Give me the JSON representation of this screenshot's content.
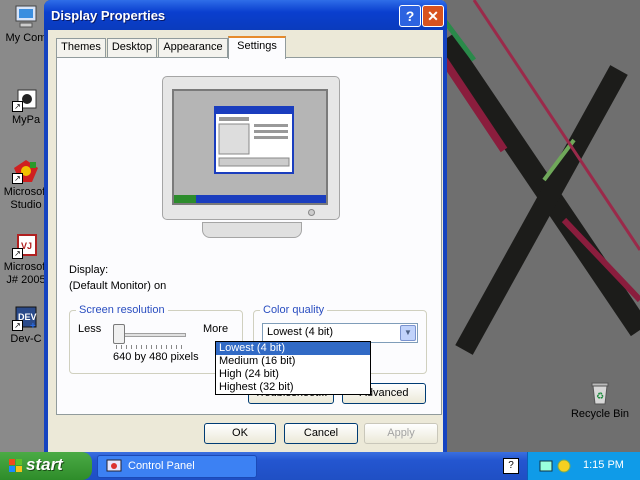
{
  "desktop": {
    "icons": [
      {
        "label": "My Com",
        "icon": "computer-icon"
      },
      {
        "label": "MyPa",
        "icon": "folder-icon"
      },
      {
        "label": "Microsoft",
        "label2": "Studio",
        "icon": "visual-studio-icon"
      },
      {
        "label": "Microsoft",
        "label2": "J# 2005",
        "icon": "vj-icon"
      },
      {
        "label": "Dev-C",
        "icon": "devcpp-icon"
      },
      {
        "label": "Recycle Bin",
        "icon": "recycle-bin-icon"
      }
    ]
  },
  "window": {
    "title": "Display Properties",
    "help_glyph": "?",
    "close_glyph": "✕",
    "tabs": [
      "Themes",
      "Desktop",
      "Appearance",
      "Settings"
    ],
    "active_tab": "Settings",
    "display_label": "Display:",
    "display_value": "(Default Monitor) on",
    "screen_resolution": {
      "legend": "Screen resolution",
      "less": "Less",
      "more": "More",
      "value": "640 by 480 pixels",
      "slider_level": 0
    },
    "color_quality": {
      "legend": "Color quality",
      "selected": "Lowest (4 bit)",
      "options": [
        "Lowest (4 bit)",
        "Medium (16 bit)",
        "High (24 bit)",
        "Highest (32 bit)"
      ]
    },
    "troubleshoot_label": "Troubleshoot...",
    "advanced_label": "Advanced",
    "ok_label": "OK",
    "cancel_label": "Cancel",
    "apply_label": "Apply"
  },
  "taskbar": {
    "start_label": "start",
    "task_label": "Control Panel",
    "tray_help": "?",
    "clock": "1:15 PM"
  },
  "colors": {
    "title_blue": "#0a3fcf",
    "start_green": "#2e8c2a",
    "selection_blue": "#316ac5",
    "tray_blue": "#0f9be8"
  }
}
